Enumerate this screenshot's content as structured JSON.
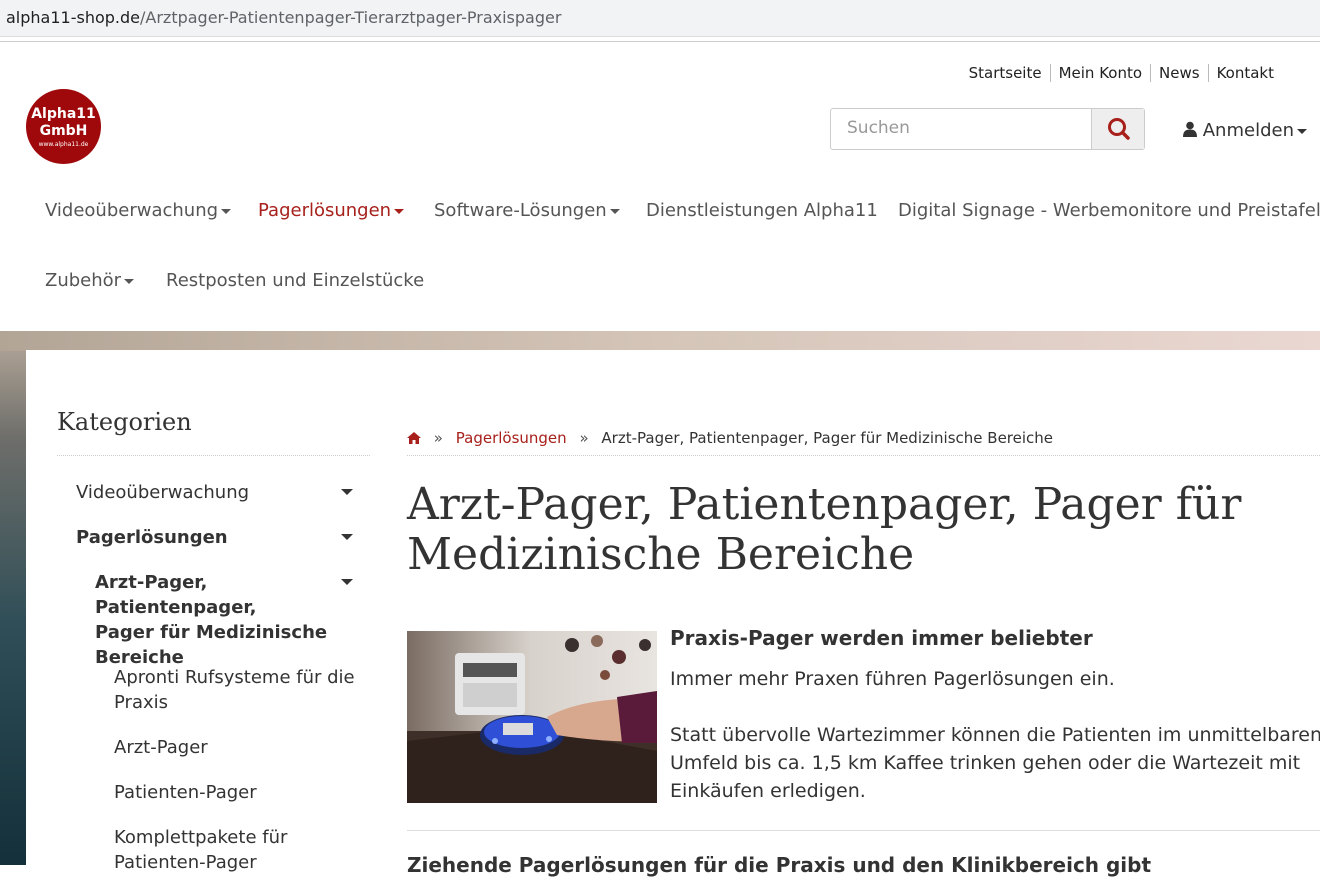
{
  "browser": {
    "url_domain": "alpha11-shop.de",
    "url_path": "/Arztpager-Patientenpager-Tierarztpager-Praxispager"
  },
  "header": {
    "top_links": [
      "Startseite",
      "Mein Konto",
      "News",
      "Kontakt"
    ],
    "logo": {
      "line1": "Alpha11",
      "line2": "GmbH",
      "line3": "www.alpha11.de"
    },
    "search_placeholder": "Suchen",
    "login_label": "Anmelden"
  },
  "nav": {
    "items": [
      {
        "label": "Videoüberwachung",
        "has_dropdown": true,
        "active": false
      },
      {
        "label": "Pagerlösungen",
        "has_dropdown": true,
        "active": true
      },
      {
        "label": "Software-Lösungen",
        "has_dropdown": true,
        "active": false
      },
      {
        "label": "Dienstleistungen Alpha11",
        "has_dropdown": false,
        "active": false
      },
      {
        "label": "Digital Signage - Werbemonitore und Preistafeln",
        "has_dropdown": true,
        "active": false
      },
      {
        "label": "Zubehör",
        "has_dropdown": true,
        "active": false
      },
      {
        "label": "Restposten und Einzelstücke",
        "has_dropdown": false,
        "active": false
      }
    ]
  },
  "sidebar": {
    "title": "Kategorien",
    "items": [
      {
        "label": "Videoüberwachung",
        "level": 1,
        "bold": false,
        "expandable": true
      },
      {
        "label": "Pagerlösungen",
        "level": 1,
        "bold": true,
        "expandable": true
      },
      {
        "label": "Arzt-Pager, Patientenpager,",
        "label2": "Pager für Medizinische",
        "label3": "Bereiche",
        "level": 2,
        "bold": true,
        "expandable": true
      },
      {
        "label": "Apronti Rufsysteme für die",
        "label2": "Praxis",
        "level": 3,
        "bold": false
      },
      {
        "label": "Arzt-Pager",
        "level": 3,
        "bold": false
      },
      {
        "label": "Patienten-Pager",
        "level": 3,
        "bold": false
      },
      {
        "label": "Komplettpakete für",
        "label2": "Patienten-Pager",
        "level": 3,
        "bold": false
      }
    ]
  },
  "breadcrumb": {
    "home_icon": "home-icon",
    "items": [
      "Pagerlösungen",
      "Arzt-Pager, Patientenpager, Pager für Medizinische Bereiche"
    ]
  },
  "main": {
    "title_line1": "Arzt-Pager, Patientenpager, Pager für",
    "title_line2": "Medizinische Bereiche",
    "section1_heading": "Praxis-Pager werden immer beliebter",
    "section1_p1": "Immer mehr Praxen führen Pagerlösungen ein.",
    "section1_p2_line1": "Statt übervolle Wartezimmer können die Patienten im unmittelbaren",
    "section1_p2_line2": "Umfeld bis ca. 1,5 km Kaffee trinken gehen oder die Wartezeit mit",
    "section1_p2_line3": "Einkäufen erledigen.",
    "section2_heading": "Ziehende Pagerlösungen für die Praxis und den Klinikbereich gibt"
  },
  "colors": {
    "brand": "#a0090b",
    "accent": "#a7201b"
  }
}
